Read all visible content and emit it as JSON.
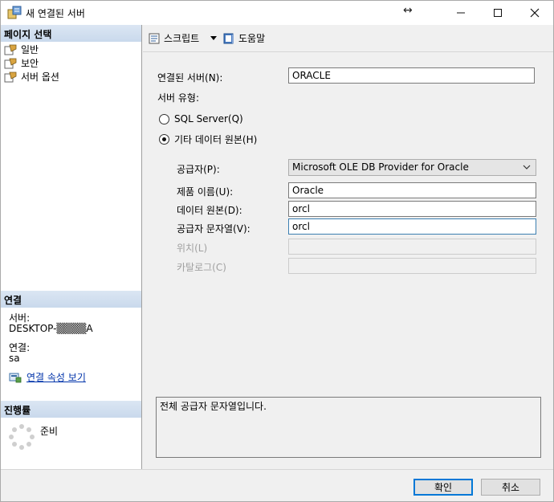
{
  "window": {
    "title": "새 연결된 서버",
    "resize_glyph": "↔",
    "minimize_glyph": "—",
    "maximize_glyph": "☐",
    "close_glyph": "✕"
  },
  "sidebar": {
    "page_select_header": "페이지 선택",
    "pages": [
      {
        "label": "일반",
        "icon": "page-wrench-icon"
      },
      {
        "label": "보안",
        "icon": "page-wrench-icon"
      },
      {
        "label": "서버 옵션",
        "icon": "page-wrench-icon"
      }
    ],
    "connection_header": "연결",
    "server_label": "서버:",
    "server_value": "DESKTOP-▒▒▒▒A",
    "connection_label": "연결:",
    "connection_value": "sa",
    "view_connection_link": "연결 속성 보기",
    "progress_header": "진행률",
    "progress_status": "준비"
  },
  "toolbar": {
    "script_label": "스크립트",
    "help_label": "도움말"
  },
  "form": {
    "linked_server_label": "연결된 서버(N):",
    "linked_server_value": "ORACLE",
    "server_type_label": "서버 유형:",
    "radio_sql_server": "SQL Server(Q)",
    "radio_other_source": "기타 데이터 원본(H)",
    "selected_server_type": "기타 데이터 원본(H)",
    "provider_label": "공급자(P):",
    "provider_value": "Microsoft OLE DB Provider for Oracle",
    "product_name_label": "제품 이름(U):",
    "product_name_value": "Oracle",
    "data_source_label": "데이터 원본(D):",
    "data_source_value": "orcl",
    "provider_string_label": "공급자 문자열(V):",
    "provider_string_value": "orcl",
    "location_label": "위치(L)",
    "location_value": "",
    "catalog_label": "카탈로그(C)",
    "catalog_value": "",
    "description": "전체 공급자 문자열입니다."
  },
  "buttons": {
    "ok": "확인",
    "cancel": "취소"
  },
  "colors": {
    "section_header": "#c9d9ec",
    "link": "#0033aa",
    "focus_border": "#0078d7"
  }
}
